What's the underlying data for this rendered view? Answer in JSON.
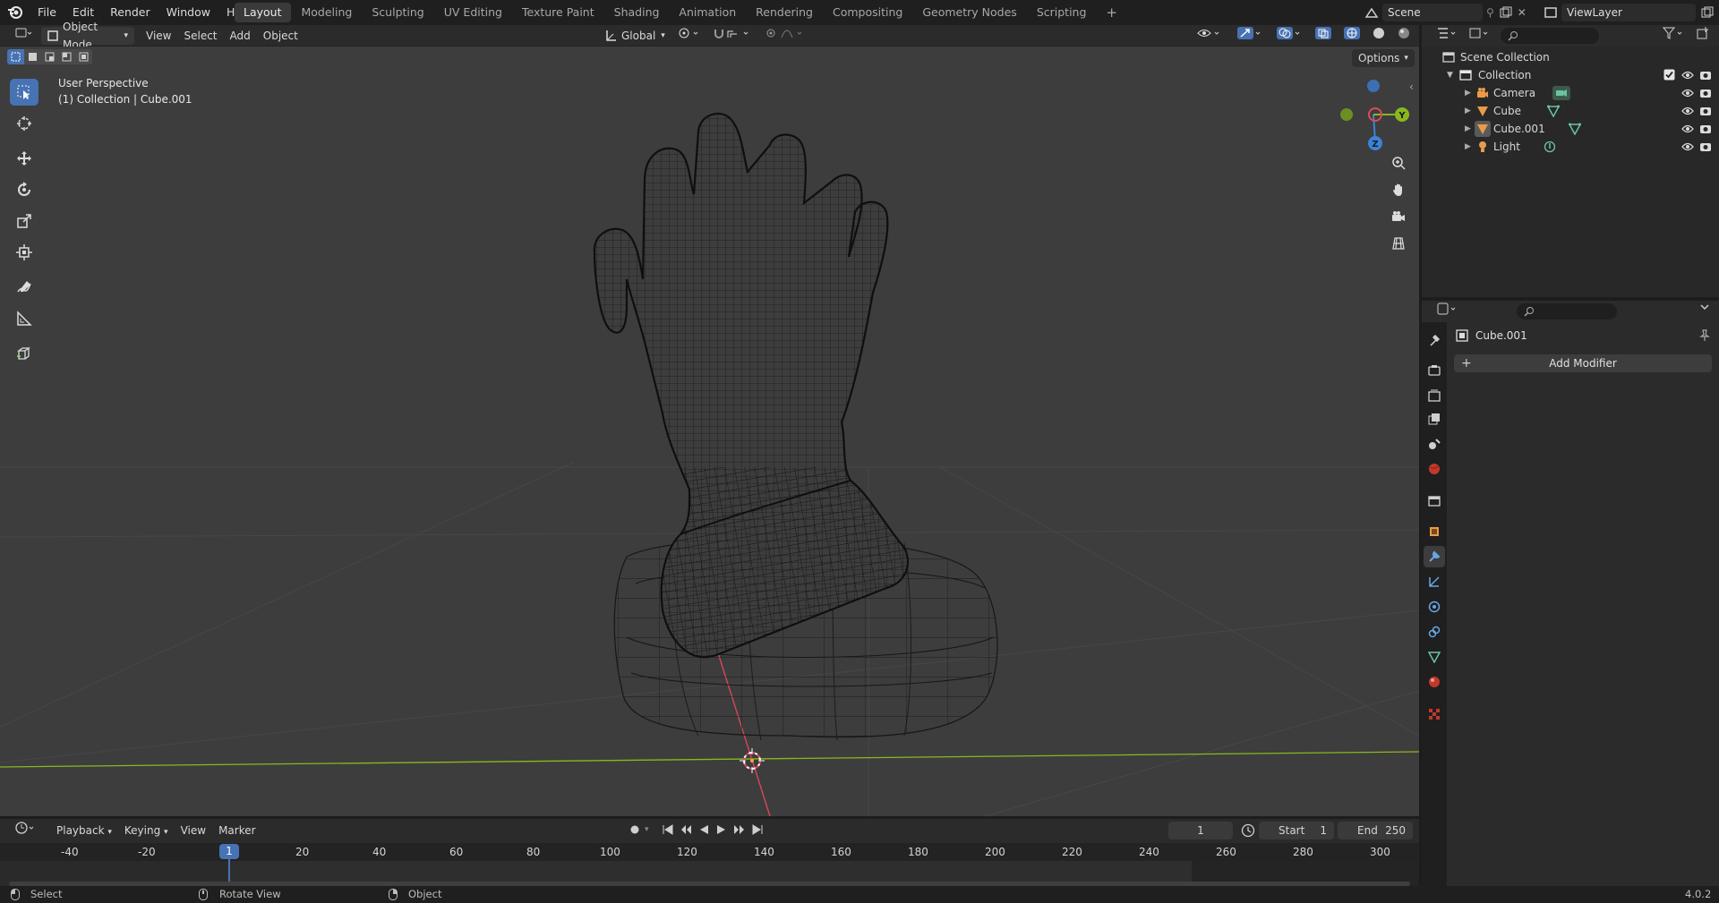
{
  "topbar": {
    "menus": [
      "File",
      "Edit",
      "Render",
      "Window",
      "Help"
    ],
    "workspaces": [
      "Layout",
      "Modeling",
      "Sculpting",
      "UV Editing",
      "Texture Paint",
      "Shading",
      "Animation",
      "Rendering",
      "Compositing",
      "Geometry Nodes",
      "Scripting"
    ],
    "active_workspace": "Layout",
    "add_tab": "+",
    "scene": "Scene",
    "view_layer": "ViewLayer"
  },
  "viewport_header": {
    "mode": "Object Mode",
    "menus": [
      "View",
      "Select",
      "Add",
      "Object"
    ],
    "transform_orientation": "Global",
    "options": "Options"
  },
  "viewport": {
    "view_name": "User Perspective",
    "context": "(1) Collection | Cube.001",
    "gizmo_axes": [
      "Y",
      "Z"
    ]
  },
  "outliner": {
    "root": "Scene Collection",
    "collection": "Collection",
    "items": [
      {
        "name": "Camera",
        "icon": "camera-icon"
      },
      {
        "name": "Cube",
        "icon": "mesh-icon"
      },
      {
        "name": "Cube.001",
        "icon": "mesh-icon"
      },
      {
        "name": "Light",
        "icon": "light-icon"
      }
    ]
  },
  "properties": {
    "object_name": "Cube.001",
    "add_modifier": "Add Modifier"
  },
  "timeline": {
    "menus": [
      "Playback",
      "Keying",
      "View",
      "Marker"
    ],
    "current_frame": "1",
    "start_label": "Start",
    "start": "1",
    "end_label": "End",
    "end": "250",
    "ticks": [
      "-40",
      "-20",
      "1",
      "20",
      "40",
      "60",
      "80",
      "100",
      "120",
      "140",
      "160",
      "180",
      "200",
      "220",
      "240",
      "260",
      "280",
      "300"
    ]
  },
  "statusbar": {
    "select": "Select",
    "rotate": "Rotate View",
    "object": "Object",
    "version": "4.0.2"
  },
  "colors": {
    "accent": "#4772b3",
    "x_axis": "#e2475a",
    "y_axis": "#89b81d",
    "z_axis": "#3c83d6",
    "viewport_bg": "#3d3d3d"
  }
}
